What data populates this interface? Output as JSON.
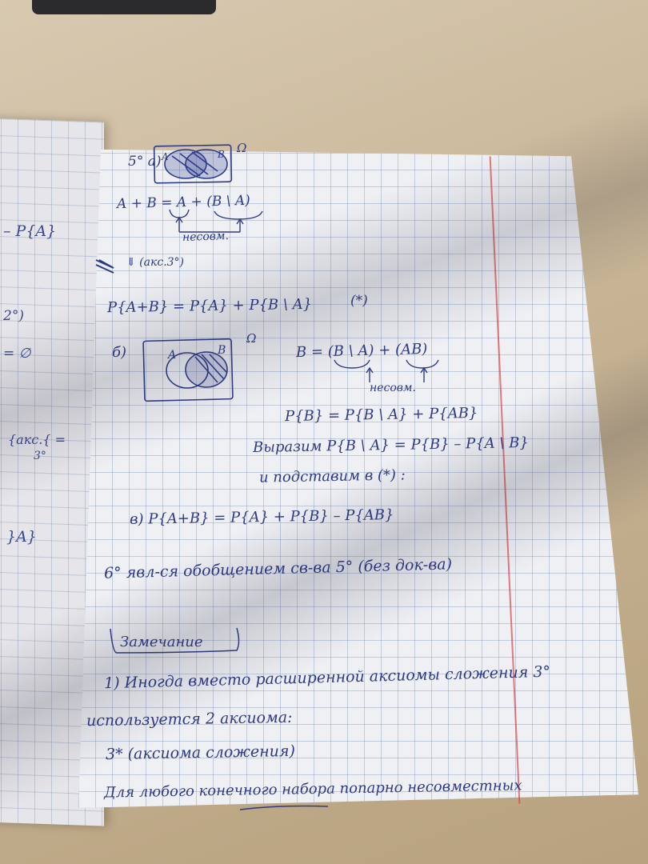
{
  "left_page": {
    "t1": "– P{A}",
    "t2": "2°)",
    "t3": "= ∅",
    "t4": "{акс.{ =",
    "t5": "3°",
    "t6": "}A}"
  },
  "right_page": {
    "line_5a": "5° а)",
    "venn1_a": "A",
    "venn1_b": "B",
    "omega1": "Ω",
    "eq1": "A + B = A + (B \\ A)",
    "nesovm1": "несовм.",
    "aks": "⇓ (акс.3°)",
    "eq2": "P{A+B} = P{A} + P{B \\ A}",
    "star": "(*)",
    "b_label": "б)",
    "venn2_a": "A",
    "venn2_b": "B",
    "omega2": "Ω",
    "eq3": "B = (B \\ A) + (AB)",
    "nesovm2": "несовм.",
    "eq4": "P{B} = P{B \\ A} + P{AB}",
    "eq5": "Выразим P{B \\ A} = P{B} – P{A \\ B}",
    "eq6": "и подставим в (*) :",
    "eq7": "в) P{A+B} = P{A} + P{B} – P{AB}",
    "line6": "6° явл-ся обобщением св-ва 5° (без док-ва)",
    "zamechanie": "Замечание",
    "note1": "1) Иногда вместо расширенной аксиомы сложения 3°",
    "note2": "используется 2 аксиома:",
    "note3": "3* (аксиома сложения)",
    "note4": "Для любого конечного набора попарно несовместных"
  }
}
